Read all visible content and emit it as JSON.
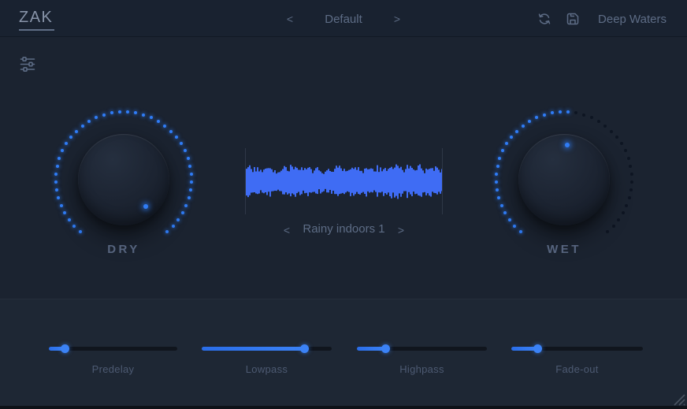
{
  "colors": {
    "accent": "#2f7cf6",
    "waveform": "#3f6cf4",
    "bg_top_bar": "#192230",
    "bg_main": "#1b2330",
    "bg_bottom": "#1e2734",
    "text_muted": "#5d6c85"
  },
  "header": {
    "logo": "ZAK",
    "preset_browser": {
      "prev": "<",
      "name": "Default",
      "next": ">"
    },
    "refresh_icon": "refresh-sync",
    "save_icon": "save-floppy",
    "bank_name": "Deep Waters"
  },
  "settings_icon": "filter-sliders",
  "knobs": [
    {
      "id": "dry",
      "label": "DRY",
      "value": 1.0
    },
    {
      "id": "wet",
      "label": "WET",
      "value": 0.52
    }
  ],
  "ir_browser": {
    "prev": "<",
    "name": "Rainy indoors 1",
    "next": ">"
  },
  "sliders": [
    {
      "id": "predelay",
      "label": "Predelay",
      "value": 0.12
    },
    {
      "id": "lowpass",
      "label": "Lowpass",
      "value": 0.79
    },
    {
      "id": "highpass",
      "label": "Highpass",
      "value": 0.22
    },
    {
      "id": "fadeout",
      "label": "Fade-out",
      "value": 0.2
    }
  ]
}
